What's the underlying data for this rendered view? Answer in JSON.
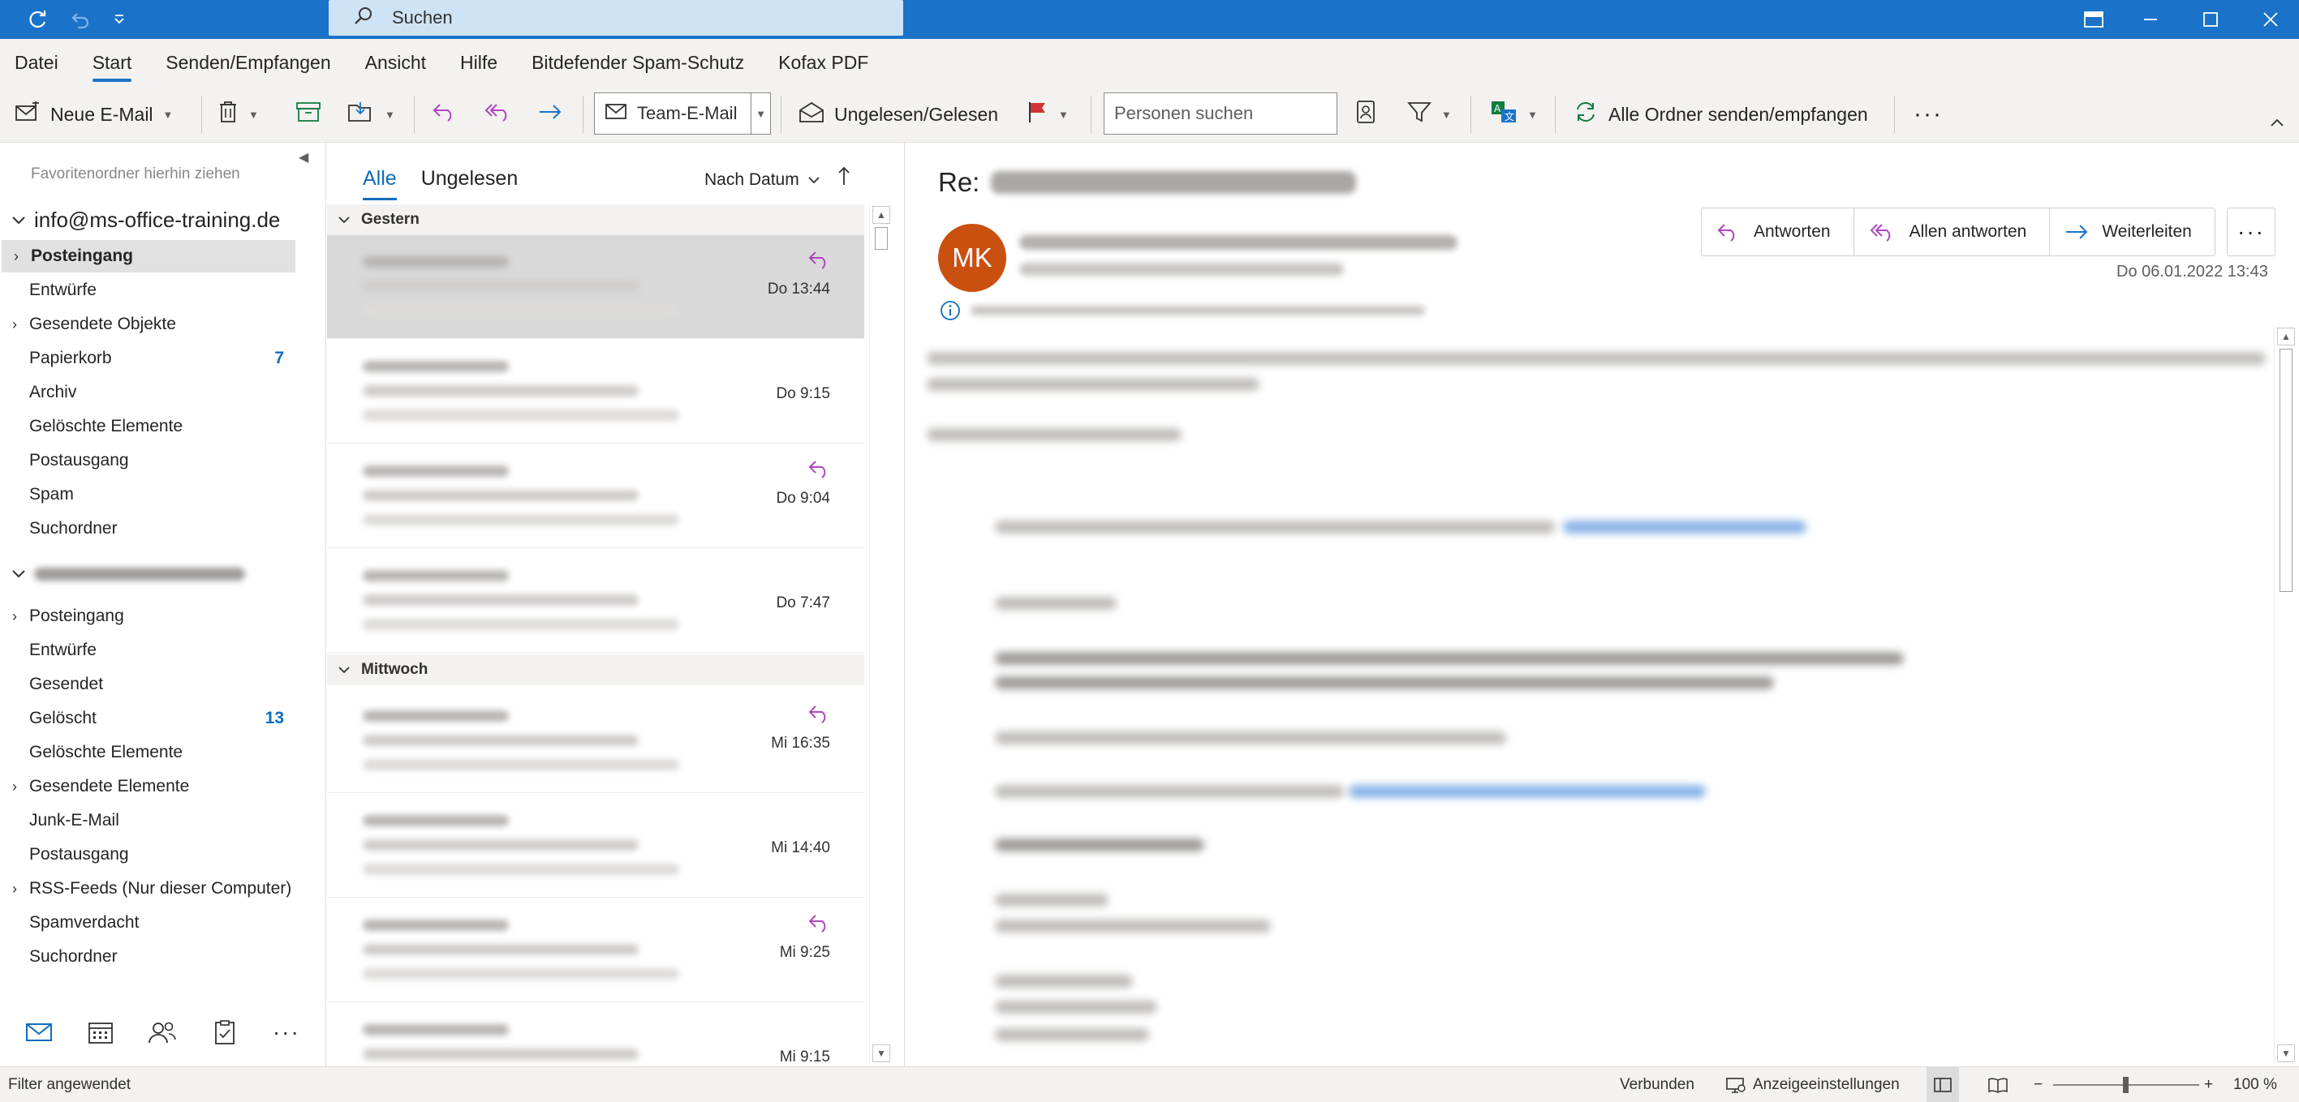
{
  "titlebar": {
    "search_placeholder": "Suchen"
  },
  "menu": {
    "items": [
      "Datei",
      "Start",
      "Senden/Empfangen",
      "Ansicht",
      "Hilfe",
      "Bitdefender Spam-Schutz",
      "Kofax PDF"
    ],
    "active": "Start"
  },
  "ribbon": {
    "new_email": "Neue E-Mail",
    "team_email": "Team-E-Mail",
    "unread_read": "Ungelesen/Gelesen",
    "people_search_placeholder": "Personen suchen",
    "send_receive_all": "Alle Ordner senden/empfangen",
    "more": "···"
  },
  "folders": {
    "favorites_drop": "Favoritenordner hierhin ziehen",
    "account1": "info@ms-office-training.de",
    "account1_folders": [
      {
        "label": "Posteingang",
        "count": "",
        "chevron": true,
        "selected": true
      },
      {
        "label": "Entwürfe",
        "count": "",
        "chevron": false
      },
      {
        "label": "Gesendete Objekte",
        "count": "",
        "chevron": true
      },
      {
        "label": "Papierkorb",
        "count": "7",
        "chevron": false
      },
      {
        "label": "Archiv",
        "count": "",
        "chevron": false
      },
      {
        "label": "Gelöschte Elemente",
        "count": "",
        "chevron": false
      },
      {
        "label": "Postausgang",
        "count": "",
        "chevron": false
      },
      {
        "label": "Spam",
        "count": "",
        "chevron": false
      },
      {
        "label": "Suchordner",
        "count": "",
        "chevron": false
      }
    ],
    "account2_folders": [
      {
        "label": "Posteingang",
        "count": "",
        "chevron": true
      },
      {
        "label": "Entwürfe",
        "count": "",
        "chevron": false
      },
      {
        "label": "Gesendet",
        "count": "",
        "chevron": false
      },
      {
        "label": "Gelöscht",
        "count": "13",
        "chevron": false
      },
      {
        "label": "Gelöschte Elemente",
        "count": "",
        "chevron": false
      },
      {
        "label": "Gesendete Elemente",
        "count": "",
        "chevron": true
      },
      {
        "label": "Junk-E-Mail",
        "count": "",
        "chevron": false
      },
      {
        "label": "Postausgang",
        "count": "",
        "chevron": false
      },
      {
        "label": "RSS-Feeds (Nur dieser Computer)",
        "count": "",
        "chevron": true
      },
      {
        "label": "Spamverdacht",
        "count": "",
        "chevron": false
      },
      {
        "label": "Suchordner",
        "count": "",
        "chevron": false
      }
    ]
  },
  "messagelist": {
    "tab_all": "Alle",
    "tab_unread": "Ungelesen",
    "sort_label": "Nach Datum",
    "group1": "Gestern",
    "group2": "Mittwoch",
    "messages": [
      {
        "time": "Do 13:44",
        "replied": true,
        "selected": true
      },
      {
        "time": "Do 9:15",
        "replied": false
      },
      {
        "time": "Do 9:04",
        "replied": true
      },
      {
        "time": "Do 7:47",
        "replied": false
      },
      {
        "time": "Mi 16:35",
        "replied": true
      },
      {
        "time": "Mi 14:40",
        "replied": false
      },
      {
        "time": "Mi 9:25",
        "replied": true
      },
      {
        "time": "Mi 9:15",
        "replied": false
      }
    ]
  },
  "reading": {
    "subject_prefix": "Re:",
    "avatar_initials": "MK",
    "reply": "Antworten",
    "reply_all": "Allen antworten",
    "forward": "Weiterleiten",
    "more": "···",
    "datetime": "Do 06.01.2022 13:43"
  },
  "status": {
    "filter": "Filter angewendet",
    "connected": "Verbunden",
    "display_settings": "Anzeigeeinstellungen",
    "zoom": "100 %"
  },
  "colors": {
    "accent": "#1a73c9",
    "avatar": "#ca5010",
    "reply_icon": "#b146c2",
    "flag": "#d13438"
  }
}
